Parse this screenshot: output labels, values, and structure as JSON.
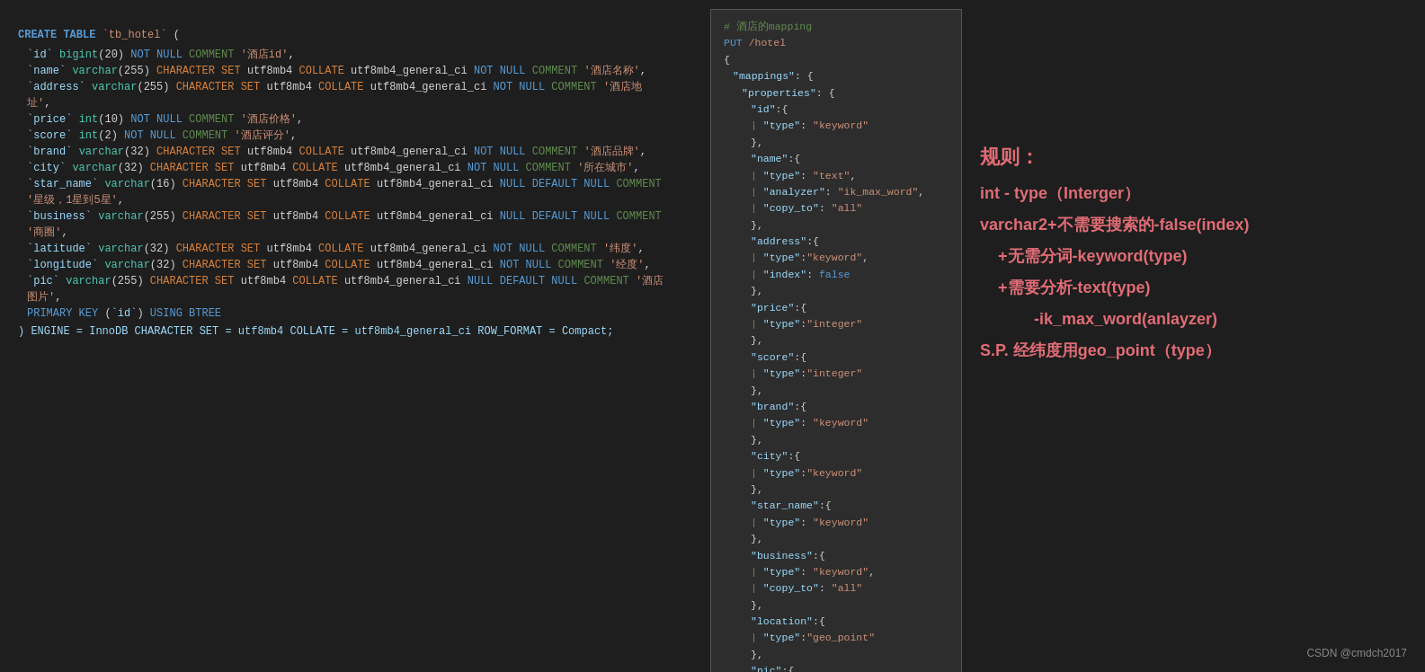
{
  "sql": {
    "create": "CREATE TABLE `tb_hotel`  (",
    "cols": [
      "`id` bigint(20) NOT NULL COMMENT '酒店id',",
      "`name` varchar(255) CHARACTER SET utf8mb4 COLLATE utf8mb4_general_ci NOT NULL COMMENT '酒店名称',",
      "`address` varchar(255) CHARACTER SET utf8mb4 COLLATE utf8mb4_general_ci NOT NULL COMMENT '酒店地址',",
      "`price` int(10) NOT NULL COMMENT '酒店价格',",
      "`score` int(2) NOT NULL COMMENT '酒店评分',",
      "`brand` varchar(32) CHARACTER SET utf8mb4 COLLATE utf8mb4_general_ci NOT NULL COMMENT '酒店品牌',",
      "`city` varchar(32) CHARACTER SET utf8mb4 COLLATE utf8mb4_general_ci NOT NULL COMMENT '所在城市',",
      "`star_name` varchar(16) CHARACTER SET utf8mb4 COLLATE utf8mb4_general_ci NULL DEFAULT NULL COMMENT '星级，1星到5星',",
      "`business` varchar(255) CHARACTER SET utf8mb4 COLLATE utf8mb4_general_ci NULL DEFAULT NULL COMMENT '商圈',",
      "`latitude` varchar(32) CHARACTER SET utf8mb4 COLLATE utf8mb4_general_ci NOT NULL COMMENT '纬度',",
      "`longitude` varchar(32) CHARACTER SET utf8mb4 COLLATE utf8mb4_general_ci NOT NULL COMMENT '经度',",
      "`pic` varchar(255) CHARACTER SET utf8mb4 COLLATE utf8mb4_general_ci NULL DEFAULT NULL COMMENT '酒店图片',"
    ],
    "primary": "PRIMARY KEY (`id`) USING BTREE",
    "engine": ") ENGINE = InnoDB CHARACTER SET = utf8mb4 COLLATE = utf8mb4_general_ci ROW_FORMAT = Compact;"
  },
  "json_panel": {
    "comment": "# 酒店的mapping",
    "method": "PUT",
    "path": "/hotel"
  },
  "rules": {
    "title": "规则：",
    "line1": "int - type（Interger）",
    "line2": "varchar2+不需要搜索的-false(index)",
    "line3": "+无需分词-keyword(type)",
    "line4": "+需要分析-text(type)",
    "line5": "-ik_max_word(anlayzer)",
    "line6": "S.P. 经纬度用geo_point（type）"
  },
  "footer": {
    "credit": "CSDN @cmdch2017"
  }
}
